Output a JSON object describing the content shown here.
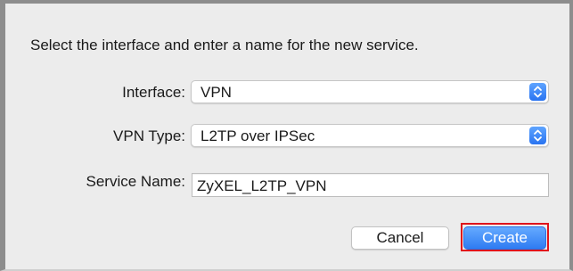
{
  "dialog": {
    "prompt": "Select the interface and enter a name for the new service."
  },
  "interface": {
    "label": "Interface:",
    "value": "VPN",
    "stepper_icon": "up-down-chevron-icon"
  },
  "vpn_type": {
    "label": "VPN Type:",
    "value": "L2TP over IPSec",
    "stepper_icon": "up-down-chevron-icon"
  },
  "service_name": {
    "label": "Service Name:",
    "value": "ZyXEL_L2TP_VPN"
  },
  "buttons": {
    "cancel": "Cancel",
    "create": "Create"
  },
  "colors": {
    "accent": "#2e7bf2",
    "highlight": "#e0141b",
    "background": "#ececec"
  }
}
